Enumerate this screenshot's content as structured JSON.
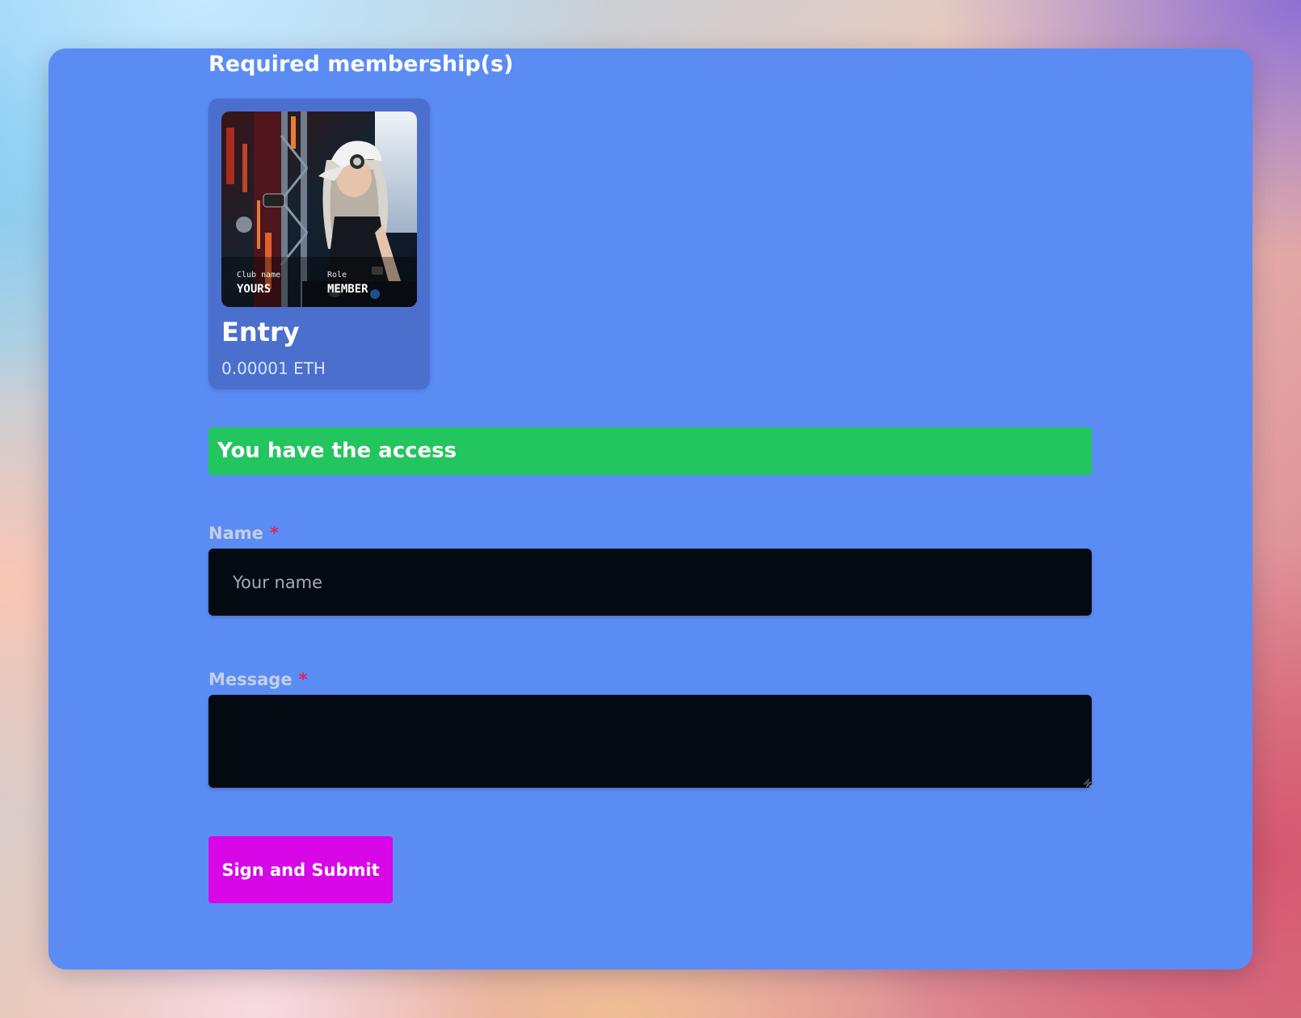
{
  "membership": {
    "section_title": "Required membership(s)",
    "card": {
      "image": {
        "club_caption": "Club name",
        "club_value": "YOURS",
        "role_caption": "Role",
        "role_value": "MEMBER"
      },
      "name": "Entry",
      "price": "0.00001 ETH"
    }
  },
  "access_banner": "You have the access",
  "form": {
    "name_label": "Name",
    "name_required": "*",
    "name_placeholder": "Your name",
    "name_value": "",
    "message_label": "Message",
    "message_required": "*",
    "message_value": "",
    "submit_label": "Sign and Submit"
  },
  "colors": {
    "panel": "#5b8cf4",
    "card": "#4b6fcc",
    "access_banner": "#22c55e",
    "input_bg": "#040a12",
    "submit_button": "#d707e8",
    "required_marker": "#e0245e"
  },
  "icons": [
    "resize-grip-icon"
  ]
}
